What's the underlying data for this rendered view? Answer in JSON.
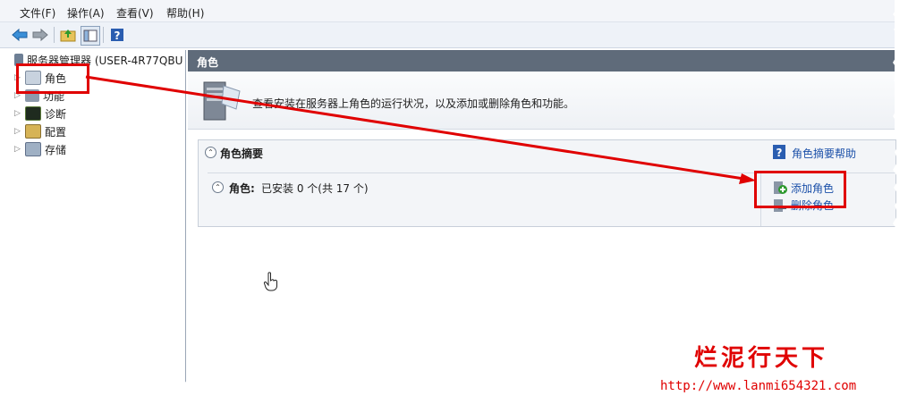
{
  "menu": [
    "文件(F)",
    "操作(A)",
    "查看(V)",
    "帮助(H)"
  ],
  "tree": {
    "root": "服务器管理器 (USER-4R77QBU",
    "items": [
      "角色",
      "功能",
      "诊断",
      "配置",
      "存储"
    ]
  },
  "header_title": "角色",
  "intro_text": "查看安装在服务器上角色的运行状况，以及添加或删除角色和功能。",
  "summary": {
    "title": "角色摘要",
    "help_link": "角色摘要帮助",
    "roles_label": "角色:",
    "roles_status": "已安装 0 个(共 17 个)",
    "add_roles": "添加角色",
    "remove_roles": "删除角色"
  },
  "watermark": {
    "title": "烂泥行天下",
    "url": "http://www.lanmi654321.com"
  },
  "colors": {
    "annotation": "#e00000",
    "header": "#5f6b7a",
    "link": "#1a4fa8"
  }
}
